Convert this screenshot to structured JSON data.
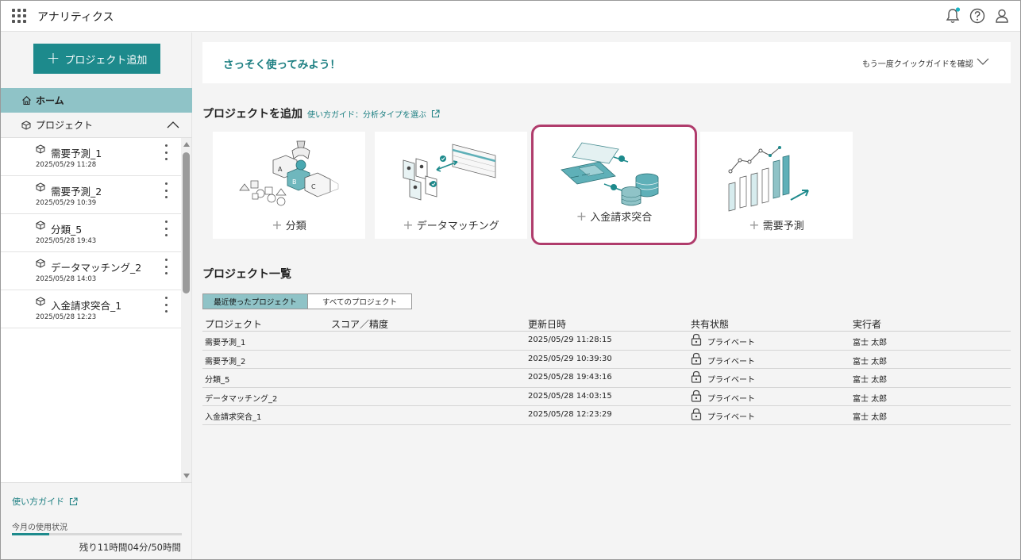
{
  "header": {
    "app_title": "アナリティクス",
    "icons": [
      "apps-grid-icon",
      "bell-icon",
      "help-icon",
      "user-icon"
    ],
    "notification_dot_color": "#1ab3c3"
  },
  "sidebar": {
    "add_project_label": "プロジェクト追加",
    "home_label": "ホーム",
    "projects_label": "プロジェクト",
    "projects": [
      {
        "name": "需要予測_1",
        "date": "2025/05/29 11:28"
      },
      {
        "name": "需要予測_2",
        "date": "2025/05/29 10:39"
      },
      {
        "name": "分類_5",
        "date": "2025/05/28 19:43"
      },
      {
        "name": "データマッチング_2",
        "date": "2025/05/28 14:03"
      },
      {
        "name": "入金請求突合_1",
        "date": "2025/05/28 12:23"
      }
    ],
    "guide_link": "使い方ガイド",
    "usage_label": "今月の使用状況",
    "usage_fraction": 0.22,
    "usage_remaining": "残り11時間04分/50時間"
  },
  "main": {
    "quick_title": "さっそく使ってみよう！",
    "quick_link": "もう一度クイックガイドを確認",
    "add_title": "プロジェクトを追加",
    "add_guide": "使い方ガイド：分析タイプを選ぶ",
    "cards": [
      {
        "label": "分類"
      },
      {
        "label": "データマッチング"
      },
      {
        "label": "入金請求突合"
      },
      {
        "label": "需要予測"
      }
    ],
    "list_title": "プロジェクト一覧",
    "tabs": [
      "最近使ったプロジェクト",
      "すべてのプロジェクト"
    ],
    "columns": [
      "プロジェクト",
      "スコア／精度",
      "更新日時",
      "共有状態",
      "実行者"
    ],
    "rows": [
      {
        "name": "需要予測_1",
        "score": "",
        "updated": "2025/05/29 11:28:15",
        "share": "プライベート",
        "owner": "富士 太郎"
      },
      {
        "name": "需要予測_2",
        "score": "",
        "updated": "2025/05/29 10:39:30",
        "share": "プライベート",
        "owner": "富士 太郎"
      },
      {
        "name": "分類_5",
        "score": "",
        "updated": "2025/05/28 19:43:16",
        "share": "プライベート",
        "owner": "富士 太郎"
      },
      {
        "name": "データマッチング_2",
        "score": "",
        "updated": "2025/05/28 14:03:15",
        "share": "プライベート",
        "owner": "富士 太郎"
      },
      {
        "name": "入金請求突合_1",
        "score": "",
        "updated": "2025/05/28 12:23:29",
        "share": "プライベート",
        "owner": "富士 太郎"
      }
    ]
  },
  "colors": {
    "accent": "#1d8a8c",
    "nav_selected": "#8fc3c7",
    "highlight_border": "#b03c6c"
  }
}
